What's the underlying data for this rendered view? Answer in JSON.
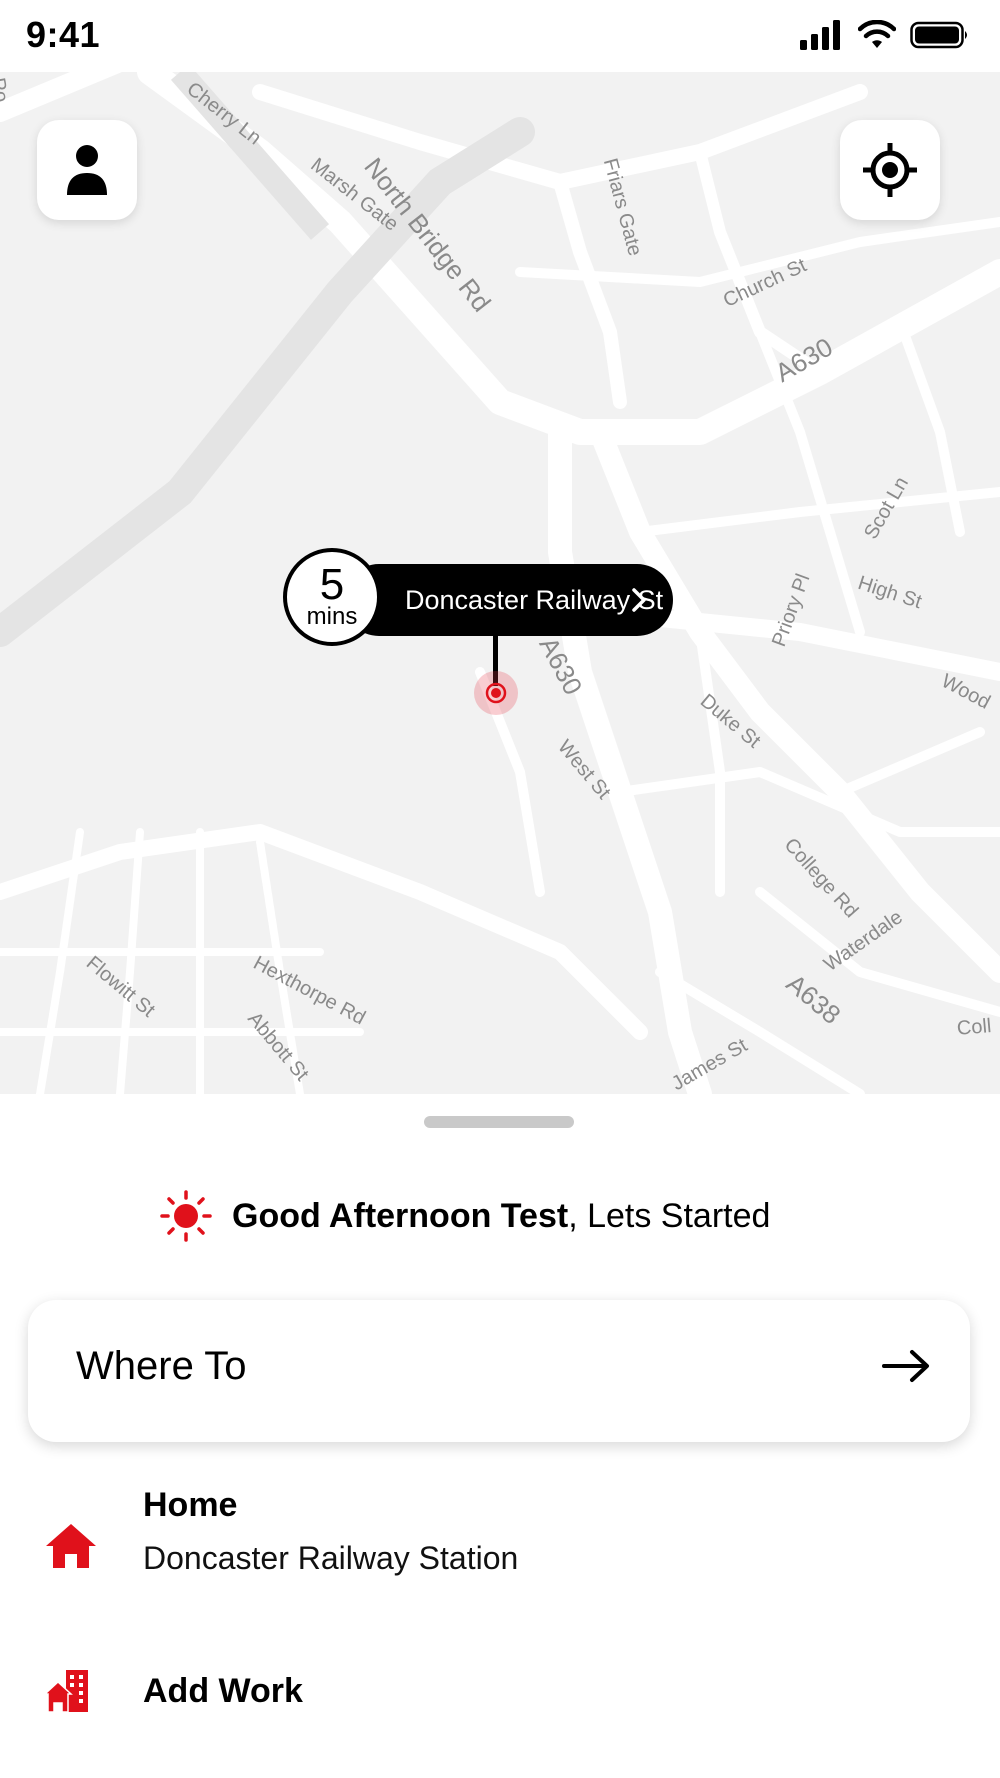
{
  "status_bar": {
    "time": "9:41"
  },
  "map": {
    "street_labels": [
      "Cherry Ln",
      "Marsh Gate",
      "North Bridge Rd",
      "Friars Gate",
      "Church St",
      "A630",
      "Scot Ln",
      "High St",
      "Priory Pl",
      "Duke St",
      "West St",
      "College Rd",
      "Waterdale",
      "A638",
      "Flowitt St",
      "Hexthorpe Rd",
      "Abbott St",
      "James St",
      "Wood",
      "Coll",
      "Po",
      "A630"
    ],
    "eta_value": "5",
    "eta_unit": "mins",
    "pickup_label": "Doncaster Railway St"
  },
  "greeting": {
    "bold": "Good Afternoon Test",
    "rest": ", Lets Started"
  },
  "search": {
    "label": "Where To"
  },
  "saved_places": [
    {
      "title": "Home",
      "subtitle": "Doncaster Railway Station",
      "icon": "home-icon"
    },
    {
      "title": "Add Work",
      "subtitle": "",
      "icon": "work-building-icon"
    }
  ],
  "colors": {
    "accent": "#e0111b",
    "pill": "#000000",
    "map_bg": "#f2f2f2"
  }
}
